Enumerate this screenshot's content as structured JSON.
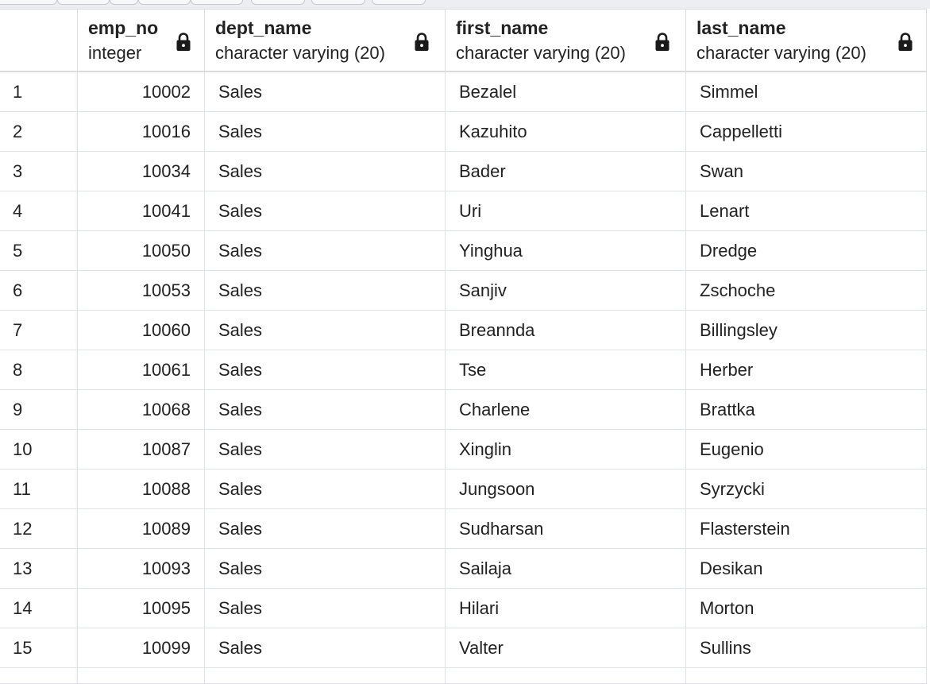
{
  "columns": [
    {
      "name": "emp_no",
      "type": "integer"
    },
    {
      "name": "dept_name",
      "type": "character varying (20)"
    },
    {
      "name": "first_name",
      "type": "character varying (20)"
    },
    {
      "name": "last_name",
      "type": "character varying (20)"
    }
  ],
  "icons": {
    "column_lock": "lock-icon"
  },
  "rows": [
    {
      "num": "1",
      "emp_no": "10002",
      "dept_name": "Sales",
      "first_name": "Bezalel",
      "last_name": "Simmel"
    },
    {
      "num": "2",
      "emp_no": "10016",
      "dept_name": "Sales",
      "first_name": "Kazuhito",
      "last_name": "Cappelletti"
    },
    {
      "num": "3",
      "emp_no": "10034",
      "dept_name": "Sales",
      "first_name": "Bader",
      "last_name": "Swan"
    },
    {
      "num": "4",
      "emp_no": "10041",
      "dept_name": "Sales",
      "first_name": "Uri",
      "last_name": "Lenart"
    },
    {
      "num": "5",
      "emp_no": "10050",
      "dept_name": "Sales",
      "first_name": "Yinghua",
      "last_name": "Dredge"
    },
    {
      "num": "6",
      "emp_no": "10053",
      "dept_name": "Sales",
      "first_name": "Sanjiv",
      "last_name": "Zschoche"
    },
    {
      "num": "7",
      "emp_no": "10060",
      "dept_name": "Sales",
      "first_name": "Breannda",
      "last_name": "Billingsley"
    },
    {
      "num": "8",
      "emp_no": "10061",
      "dept_name": "Sales",
      "first_name": "Tse",
      "last_name": "Herber"
    },
    {
      "num": "9",
      "emp_no": "10068",
      "dept_name": "Sales",
      "first_name": "Charlene",
      "last_name": "Brattka"
    },
    {
      "num": "10",
      "emp_no": "10087",
      "dept_name": "Sales",
      "first_name": "Xinglin",
      "last_name": "Eugenio"
    },
    {
      "num": "11",
      "emp_no": "10088",
      "dept_name": "Sales",
      "first_name": "Jungsoon",
      "last_name": "Syrzycki"
    },
    {
      "num": "12",
      "emp_no": "10089",
      "dept_name": "Sales",
      "first_name": "Sudharsan",
      "last_name": "Flasterstein"
    },
    {
      "num": "13",
      "emp_no": "10093",
      "dept_name": "Sales",
      "first_name": "Sailaja",
      "last_name": "Desikan"
    },
    {
      "num": "14",
      "emp_no": "10095",
      "dept_name": "Sales",
      "first_name": "Hilari",
      "last_name": "Morton"
    },
    {
      "num": "15",
      "emp_no": "10099",
      "dept_name": "Sales",
      "first_name": "Valter",
      "last_name": "Sullins"
    }
  ]
}
